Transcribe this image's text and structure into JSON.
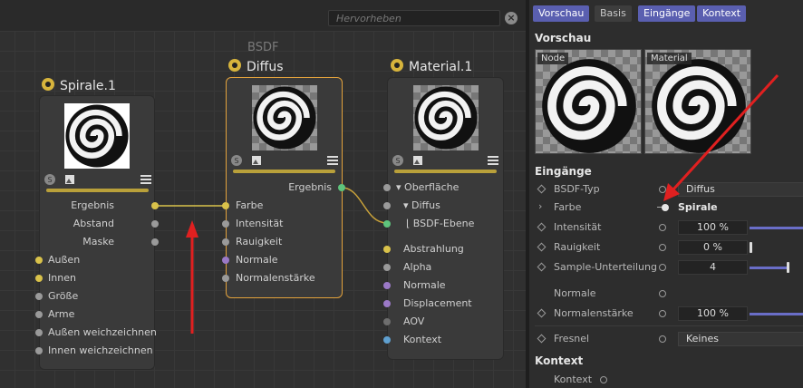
{
  "search": {
    "placeholder": "Hervorheben"
  },
  "group_label": "BSDF",
  "nodes": {
    "spirale": {
      "title": "Spirale.1",
      "outputs": [
        "Ergebnis",
        "Abstand",
        "Maske"
      ],
      "inputs": [
        "Außen",
        "Innen",
        "Größe",
        "Arme",
        "Außen weichzeichnen",
        "Innen weichzeichnen"
      ]
    },
    "diffus": {
      "title": "Diffus",
      "output": "Ergebnis",
      "inputs": [
        "Farbe",
        "Intensität",
        "Rauigkeit",
        "Normale",
        "Normalenstärke"
      ]
    },
    "material": {
      "title": "Material.1",
      "inputs": [
        "Oberfläche",
        "Diffus",
        "BSDF-Ebene",
        "Abstrahlung",
        "Alpha",
        "Normale",
        "Displacement",
        "AOV",
        "Kontext"
      ]
    }
  },
  "tabs": [
    "Vorschau",
    "Basis",
    "Eingänge",
    "Kontext"
  ],
  "sections": {
    "vorschau": "Vorschau",
    "eingaenge": "Eingänge",
    "kontext": "Kontext"
  },
  "preview_labels": {
    "node": "Node",
    "material": "Material"
  },
  "attributes": {
    "bsdf_typ": {
      "label": "BSDF-Typ",
      "value": "Diffus"
    },
    "farbe": {
      "label": "Farbe",
      "value": "Spirale"
    },
    "intensitaet": {
      "label": "Intensität",
      "value": "100 %",
      "level": 1.0
    },
    "rauigkeit": {
      "label": "Rauigkeit",
      "value": "0 %",
      "level": 0.0
    },
    "sample": {
      "label": "Sample-Unterteilung",
      "value": "4",
      "level": 0.67
    },
    "normale": {
      "label": "Normale"
    },
    "normalenstaerke": {
      "label": "Normalenstärke",
      "value": "100 %",
      "level": 1.0
    },
    "fresnel": {
      "label": "Fresnel",
      "value": "Keines"
    },
    "kontext": {
      "label": "Kontext"
    }
  },
  "colors": {
    "accent": "#5a5fb0",
    "selection": "#e3a23c",
    "annotation_arrow": "#e02020",
    "wire": "#d9c24a"
  }
}
